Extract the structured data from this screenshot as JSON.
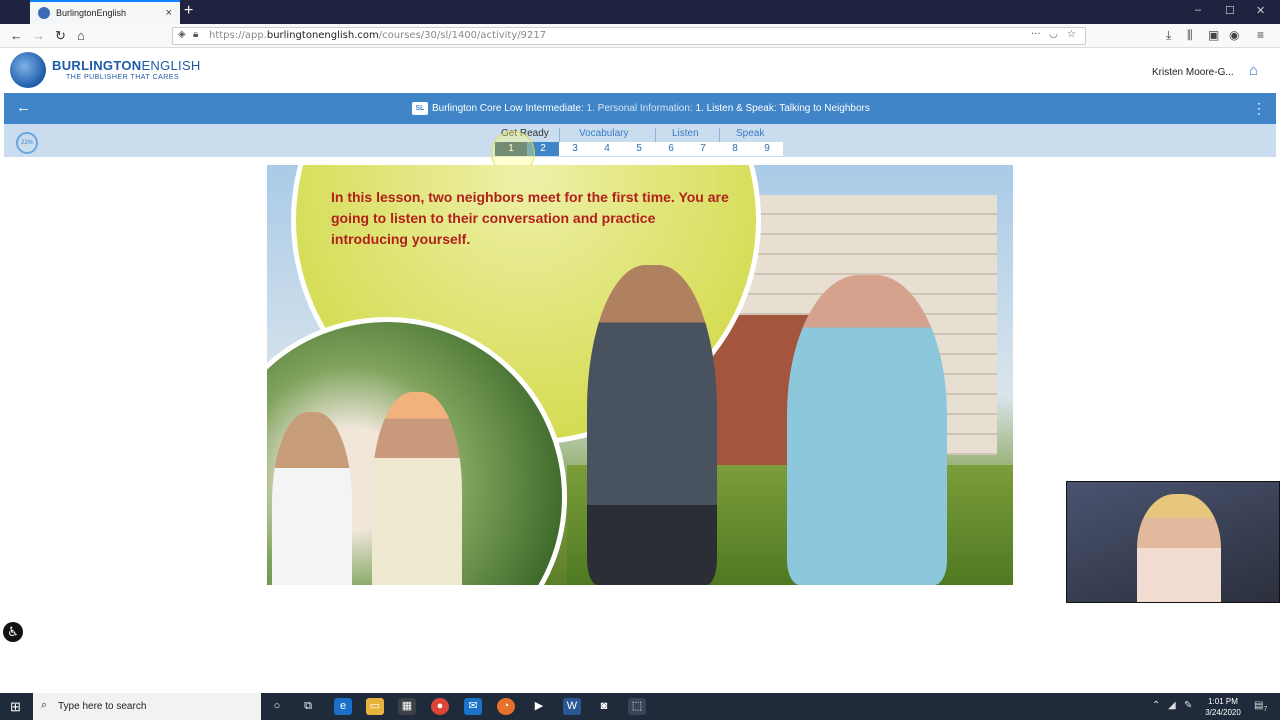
{
  "browser": {
    "tab_title": "BurlingtonEnglish",
    "tab_close": "×",
    "new_tab": "+",
    "url_prefix": "https://app.",
    "url_domain": "burlingtonenglish.com",
    "url_path": "/courses/30/sl/1400/activity/9217",
    "window_controls": [
      "–",
      "☐",
      "✕"
    ]
  },
  "header": {
    "logo_bold": "BURLINGTON",
    "logo_light": "ENGLISH",
    "logo_tagline": "THE PUBLISHER THAT CARES",
    "user_name": "Kristen Moore-G..."
  },
  "course_bar": {
    "badge": "SL",
    "course": "Burlington Core Low Intermediate:",
    "unit": "1. Personal Information:",
    "activity": "1. Listen & Speak: Talking to Neighbors"
  },
  "stepper": {
    "progress": "22%",
    "progress_fraction": 0.22,
    "sections": [
      "Get Ready",
      "Vocabulary",
      "Listen",
      "Speak"
    ],
    "steps": [
      "1",
      "2",
      "3",
      "4",
      "5",
      "6",
      "7",
      "8",
      "9"
    ],
    "current_step": "1"
  },
  "lesson": {
    "text": "In this lesson, two neighbors meet for the first time. You are going to listen to their conversation and practice introducing yourself."
  },
  "taskbar": {
    "search_placeholder": "Type here to search",
    "time": "1:01 PM",
    "date": "3/24/2020",
    "notifications": "7"
  },
  "colors": {
    "primary_blue": "#3f85c7",
    "stepper_bg": "#c9ddef",
    "lesson_text": "#b2201c",
    "current_step": "#2c4f72"
  }
}
